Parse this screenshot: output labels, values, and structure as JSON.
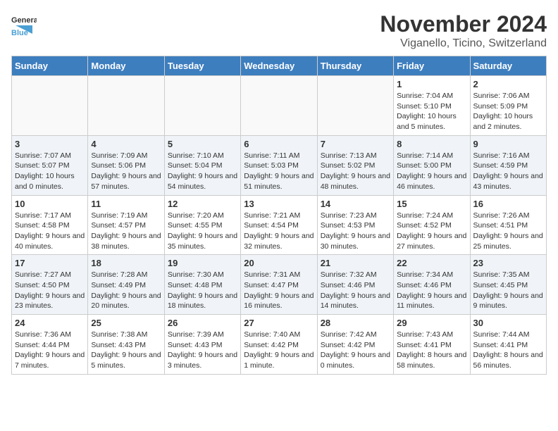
{
  "header": {
    "logo_general": "General",
    "logo_blue": "Blue",
    "month": "November 2024",
    "location": "Viganello, Ticino, Switzerland"
  },
  "weekdays": [
    "Sunday",
    "Monday",
    "Tuesday",
    "Wednesday",
    "Thursday",
    "Friday",
    "Saturday"
  ],
  "weeks": [
    [
      {
        "day": "",
        "info": ""
      },
      {
        "day": "",
        "info": ""
      },
      {
        "day": "",
        "info": ""
      },
      {
        "day": "",
        "info": ""
      },
      {
        "day": "",
        "info": ""
      },
      {
        "day": "1",
        "info": "Sunrise: 7:04 AM\nSunset: 5:10 PM\nDaylight: 10 hours and 5 minutes."
      },
      {
        "day": "2",
        "info": "Sunrise: 7:06 AM\nSunset: 5:09 PM\nDaylight: 10 hours and 2 minutes."
      }
    ],
    [
      {
        "day": "3",
        "info": "Sunrise: 7:07 AM\nSunset: 5:07 PM\nDaylight: 10 hours and 0 minutes."
      },
      {
        "day": "4",
        "info": "Sunrise: 7:09 AM\nSunset: 5:06 PM\nDaylight: 9 hours and 57 minutes."
      },
      {
        "day": "5",
        "info": "Sunrise: 7:10 AM\nSunset: 5:04 PM\nDaylight: 9 hours and 54 minutes."
      },
      {
        "day": "6",
        "info": "Sunrise: 7:11 AM\nSunset: 5:03 PM\nDaylight: 9 hours and 51 minutes."
      },
      {
        "day": "7",
        "info": "Sunrise: 7:13 AM\nSunset: 5:02 PM\nDaylight: 9 hours and 48 minutes."
      },
      {
        "day": "8",
        "info": "Sunrise: 7:14 AM\nSunset: 5:00 PM\nDaylight: 9 hours and 46 minutes."
      },
      {
        "day": "9",
        "info": "Sunrise: 7:16 AM\nSunset: 4:59 PM\nDaylight: 9 hours and 43 minutes."
      }
    ],
    [
      {
        "day": "10",
        "info": "Sunrise: 7:17 AM\nSunset: 4:58 PM\nDaylight: 9 hours and 40 minutes."
      },
      {
        "day": "11",
        "info": "Sunrise: 7:19 AM\nSunset: 4:57 PM\nDaylight: 9 hours and 38 minutes."
      },
      {
        "day": "12",
        "info": "Sunrise: 7:20 AM\nSunset: 4:55 PM\nDaylight: 9 hours and 35 minutes."
      },
      {
        "day": "13",
        "info": "Sunrise: 7:21 AM\nSunset: 4:54 PM\nDaylight: 9 hours and 32 minutes."
      },
      {
        "day": "14",
        "info": "Sunrise: 7:23 AM\nSunset: 4:53 PM\nDaylight: 9 hours and 30 minutes."
      },
      {
        "day": "15",
        "info": "Sunrise: 7:24 AM\nSunset: 4:52 PM\nDaylight: 9 hours and 27 minutes."
      },
      {
        "day": "16",
        "info": "Sunrise: 7:26 AM\nSunset: 4:51 PM\nDaylight: 9 hours and 25 minutes."
      }
    ],
    [
      {
        "day": "17",
        "info": "Sunrise: 7:27 AM\nSunset: 4:50 PM\nDaylight: 9 hours and 23 minutes."
      },
      {
        "day": "18",
        "info": "Sunrise: 7:28 AM\nSunset: 4:49 PM\nDaylight: 9 hours and 20 minutes."
      },
      {
        "day": "19",
        "info": "Sunrise: 7:30 AM\nSunset: 4:48 PM\nDaylight: 9 hours and 18 minutes."
      },
      {
        "day": "20",
        "info": "Sunrise: 7:31 AM\nSunset: 4:47 PM\nDaylight: 9 hours and 16 minutes."
      },
      {
        "day": "21",
        "info": "Sunrise: 7:32 AM\nSunset: 4:46 PM\nDaylight: 9 hours and 14 minutes."
      },
      {
        "day": "22",
        "info": "Sunrise: 7:34 AM\nSunset: 4:46 PM\nDaylight: 9 hours and 11 minutes."
      },
      {
        "day": "23",
        "info": "Sunrise: 7:35 AM\nSunset: 4:45 PM\nDaylight: 9 hours and 9 minutes."
      }
    ],
    [
      {
        "day": "24",
        "info": "Sunrise: 7:36 AM\nSunset: 4:44 PM\nDaylight: 9 hours and 7 minutes."
      },
      {
        "day": "25",
        "info": "Sunrise: 7:38 AM\nSunset: 4:43 PM\nDaylight: 9 hours and 5 minutes."
      },
      {
        "day": "26",
        "info": "Sunrise: 7:39 AM\nSunset: 4:43 PM\nDaylight: 9 hours and 3 minutes."
      },
      {
        "day": "27",
        "info": "Sunrise: 7:40 AM\nSunset: 4:42 PM\nDaylight: 9 hours and 1 minute."
      },
      {
        "day": "28",
        "info": "Sunrise: 7:42 AM\nSunset: 4:42 PM\nDaylight: 9 hours and 0 minutes."
      },
      {
        "day": "29",
        "info": "Sunrise: 7:43 AM\nSunset: 4:41 PM\nDaylight: 8 hours and 58 minutes."
      },
      {
        "day": "30",
        "info": "Sunrise: 7:44 AM\nSunset: 4:41 PM\nDaylight: 8 hours and 56 minutes."
      }
    ]
  ]
}
